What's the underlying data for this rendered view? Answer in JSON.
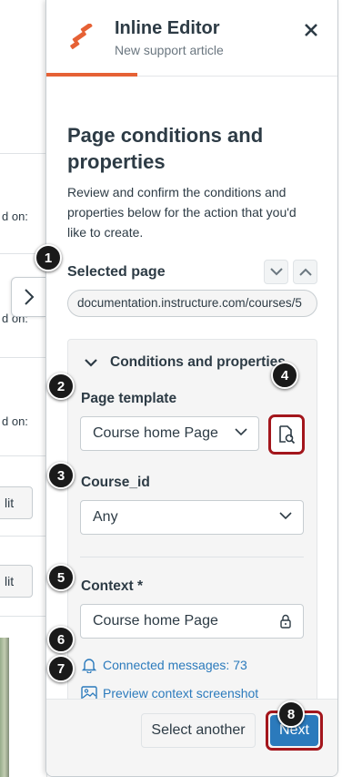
{
  "background": {
    "labels": [
      "d on:",
      "d on:",
      "d on:"
    ],
    "buttons": [
      "lit",
      "lit"
    ]
  },
  "header": {
    "title": "Inline Editor",
    "subtitle": "New support article"
  },
  "page": {
    "title": "Page conditions and properties",
    "description": "Review and confirm the conditions and properties below for the action that you'd like to create."
  },
  "selected_page": {
    "label": "Selected page",
    "url": "documentation.instructure.com/courses/5"
  },
  "conditions": {
    "heading": "Conditions and properties",
    "template_label": "Page template",
    "template_value": "Course home Page",
    "course_label": "Course_id",
    "course_value": "Any",
    "context_label": "Context *",
    "context_value": "Course home Page",
    "connected_messages": "Connected messages: 73",
    "preview_screenshot": "Preview context screenshot"
  },
  "footer": {
    "secondary": "Select another",
    "primary": "Next"
  },
  "callouts": [
    "1",
    "2",
    "3",
    "4",
    "5",
    "6",
    "7",
    "8"
  ],
  "colors": {
    "accent": "#e66135",
    "link": "#2b7abc",
    "primary_button": "#2b7abc",
    "highlight_border": "#a3161c"
  }
}
